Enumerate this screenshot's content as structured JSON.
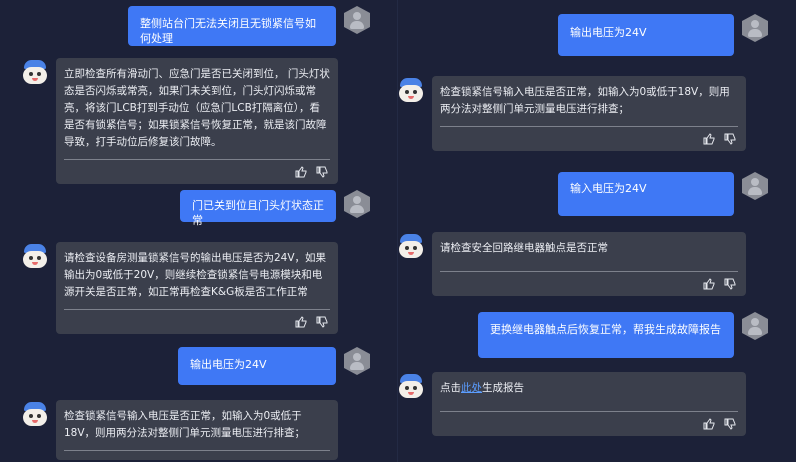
{
  "left": {
    "messages": [
      {
        "role": "user",
        "text": "整侧站台门无法关闭且无锁紧信号如何处理"
      },
      {
        "role": "bot",
        "text": "立即检查所有滑动门、应急门是否已关闭到位， 门头灯状态是否闪烁或常亮，如果门未关到位，门头灯闪烁或常亮，将该门LCB打到手动位（应急门LCB打隔离位），看是否有锁紧信号；如果锁紧信号恢复正常，就是该门故障导致，打手动位后修复该门故障。"
      },
      {
        "role": "user",
        "text": "门已关到位且门头灯状态正常"
      },
      {
        "role": "bot",
        "text": "请检查设备房测量锁紧信号的输出电压是否为24V，如果输出为0或低于20V，则继续检查锁紧信号电源模块和电源开关是否正常，如正常再检查K&G板是否工作正常"
      },
      {
        "role": "user",
        "text": "输出电压为24V"
      },
      {
        "role": "bot",
        "text": "检查锁紧信号输入电压是否正常，如输入为0或低于18V，则用两分法对整侧门单元测量电压进行排查；"
      }
    ]
  },
  "right": {
    "messages": [
      {
        "role": "user",
        "text": "输出电压为24V"
      },
      {
        "role": "bot",
        "text": "检查锁紧信号输入电压是否正常，如输入为0或低于18V，则用两分法对整侧门单元测量电压进行排查；"
      },
      {
        "role": "user",
        "text": "输入电压为24V"
      },
      {
        "role": "bot",
        "text": "请检查安全回路继电器触点是否正常"
      },
      {
        "role": "user",
        "text": "更换继电器触点后恢复正常，帮我生成故障报告"
      },
      {
        "role": "bot",
        "text_before": "点击",
        "link": "此处",
        "text_after": "生成报告"
      }
    ]
  },
  "icons": {
    "like": "thumb-up-icon",
    "dislike": "thumb-down-icon"
  },
  "colors": {
    "background": "#1c2138",
    "user_bubble": "#3f78f5",
    "bot_bubble": "#3b3f4c",
    "link": "#5b9dff"
  }
}
